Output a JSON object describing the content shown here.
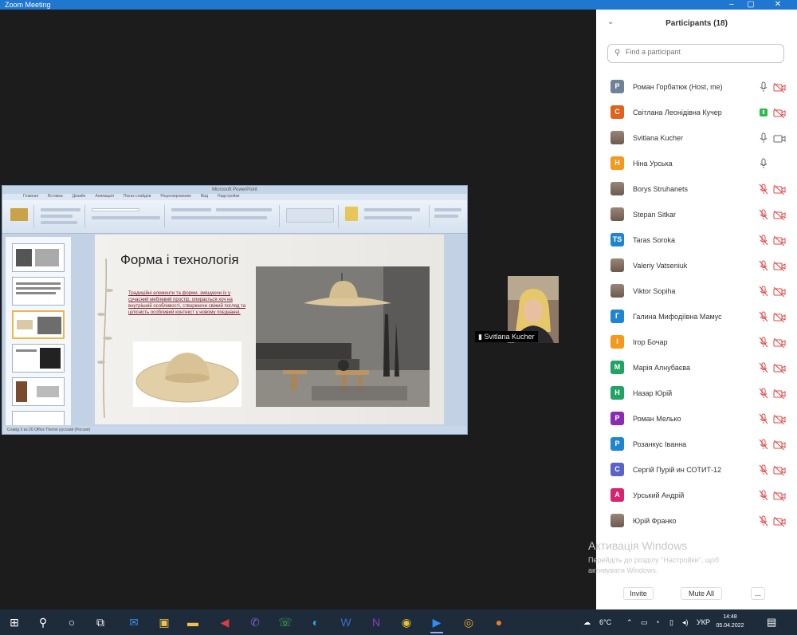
{
  "window": {
    "title": "Zoom Meeting",
    "minimize": "‒",
    "maximize": "▢",
    "close": "✕"
  },
  "shared_screen": {
    "app_title": "Microsoft PowerPoint",
    "tabs": [
      "Главная",
      "Вставка",
      "Дизайн",
      "Анимация",
      "Показ слайдов",
      "Рецензирование",
      "Вид",
      "Надстройки"
    ],
    "slide": {
      "title": "Форма і технологія",
      "body": "Традиційні елементи та форми, зміщуючи їх у сучасний меблевий простір, опирається хоч на внутрішній особливості, створюючи свіжий погляд та цілісність особливий контекст у новому поєднанні."
    },
    "status_bar": "Слайд 3 из 26   Office Theme   русский (Россия)"
  },
  "video_tile": {
    "name": "Svitlana Kucher"
  },
  "participants": {
    "title": "Participants (18)",
    "search_placeholder": "Find a participant",
    "list": [
      {
        "initial": "P",
        "color": "#6f8296",
        "name": "Роман Горбатюк (Host, me)",
        "mic": "on",
        "cam": "off"
      },
      {
        "initial": "С",
        "color": "#e0621c",
        "name": "Світлана Леонідівна Кучер",
        "mic": "active",
        "cam": "off"
      },
      {
        "initial": "",
        "color": "",
        "name": "Svitlana Kucher",
        "mic": "on",
        "cam": "on",
        "avatar": "photo"
      },
      {
        "initial": "Н",
        "color": "#f39a1d",
        "name": "Ніна Урська",
        "mic": "on",
        "cam": "none"
      },
      {
        "initial": "",
        "color": "",
        "name": "Borys Struhanets",
        "mic": "off",
        "cam": "off",
        "avatar": "photo"
      },
      {
        "initial": "",
        "color": "",
        "name": "Stepan Sitkar",
        "mic": "off",
        "cam": "off",
        "avatar": "photo"
      },
      {
        "initial": "TS",
        "color": "#1f85d0",
        "name": "Taras Soroka",
        "mic": "off",
        "cam": "off"
      },
      {
        "initial": "",
        "color": "",
        "name": "Valeriy Vatseniuk",
        "mic": "off",
        "cam": "off",
        "avatar": "photo"
      },
      {
        "initial": "",
        "color": "",
        "name": "Viktor Sopiha",
        "mic": "off",
        "cam": "off",
        "avatar": "photo"
      },
      {
        "initial": "Г",
        "color": "#1f85d0",
        "name": "Галина Мифодіївна Мамус",
        "mic": "off",
        "cam": "off"
      },
      {
        "initial": "І",
        "color": "#f39a1d",
        "name": "Ігор Бочар",
        "mic": "off",
        "cam": "off"
      },
      {
        "initial": "М",
        "color": "#21a366",
        "name": "Марія Алнубаєва",
        "mic": "off",
        "cam": "off"
      },
      {
        "initial": "Н",
        "color": "#21a366",
        "name": "Назар Юрій",
        "mic": "off",
        "cam": "off"
      },
      {
        "initial": "Р",
        "color": "#8a2bb3",
        "name": "Роман Мелько",
        "mic": "off",
        "cam": "off"
      },
      {
        "initial": "Р",
        "color": "#1f85d0",
        "name": "Розанкус Іванна",
        "mic": "off",
        "cam": "off"
      },
      {
        "initial": "С",
        "color": "#5a64c8",
        "name": "Сергій Пурій ин СОТИТ-12",
        "mic": "off",
        "cam": "off"
      },
      {
        "initial": "А",
        "color": "#d6246e",
        "name": "Урський Андрій",
        "mic": "off",
        "cam": "off"
      },
      {
        "initial": "",
        "color": "",
        "name": "Юрій Франко",
        "mic": "off",
        "cam": "off",
        "avatar": "photo"
      }
    ],
    "invite_label": "Invite",
    "mute_all_label": "Mute All",
    "more_label": "..."
  },
  "windows_activation": {
    "line1": "Активація Windows",
    "line2": "Перейдіть до розділу \"Настройки\", щоб",
    "line3": "активувати Windows."
  },
  "taskbar": {
    "weather": "6°C",
    "language": "УКР",
    "time": "14:48",
    "date": "05.04.2022",
    "icons": [
      "windows-icon",
      "search-icon",
      "cortana-icon",
      "task-view-icon",
      "mail-icon",
      "store-icon",
      "explorer-icon",
      "app-red-icon",
      "viber-icon",
      "whatsapp-icon",
      "edge-icon",
      "word-icon",
      "onenote-icon",
      "chrome-icon",
      "zoom-icon",
      "chrome-canary-icon",
      "firefox-icon"
    ]
  }
}
